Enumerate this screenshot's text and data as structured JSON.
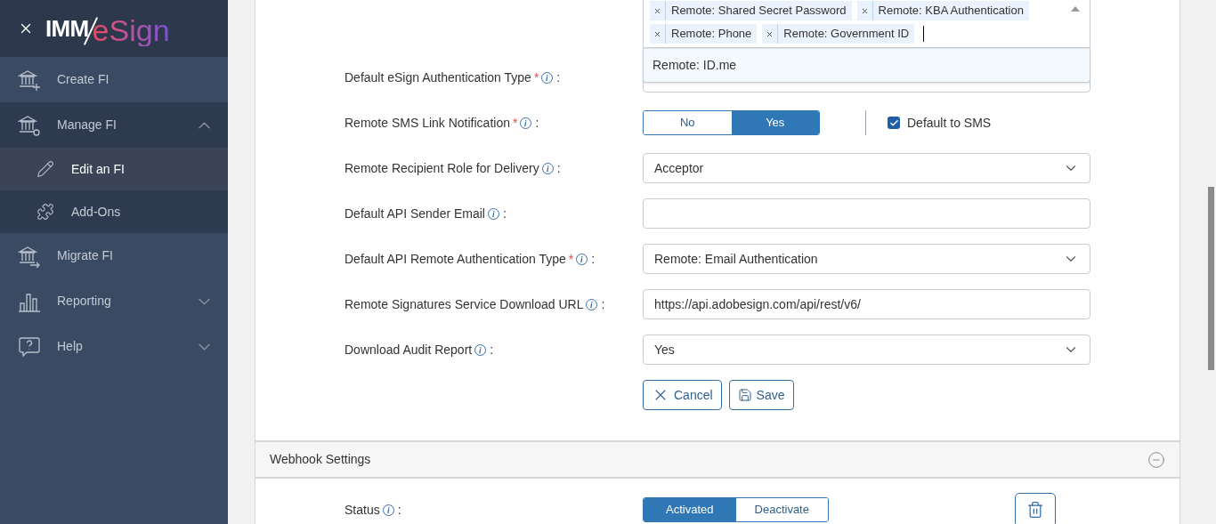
{
  "sidebar": {
    "logo": {
      "left": "IMM",
      "right": "eSign"
    },
    "items": [
      {
        "label": "Create FI",
        "selected": false
      },
      {
        "label": "Manage FI",
        "selected": false,
        "expanded": true,
        "children": [
          {
            "label": "Edit an FI",
            "selected": true
          },
          {
            "label": "Add-Ons",
            "selected": false
          }
        ]
      },
      {
        "label": "Migrate FI",
        "selected": false
      },
      {
        "label": "Reporting",
        "selected": false,
        "expanded": false
      },
      {
        "label": "Help",
        "selected": false,
        "expanded": false
      }
    ]
  },
  "auth_dropdown": {
    "chips": [
      "Remote: Shared Secret Password",
      "Remote: KBA Authentication",
      "Remote: Phone",
      "Remote: Government ID"
    ],
    "options": [
      "Remote: ID.me"
    ]
  },
  "form": [
    {
      "kind": "select",
      "label": "Default eSign Authentication Type",
      "required_mark": "*",
      "colon": ":"
    },
    {
      "kind": "toggle",
      "label": "Remote SMS Link Notification",
      "required_mark": "*",
      "colon": ":",
      "options": [
        {
          "label": "No",
          "selected": false
        },
        {
          "label": "Yes",
          "selected": true
        }
      ],
      "checkbox": {
        "label": "Default to SMS",
        "checked": true
      }
    },
    {
      "kind": "select",
      "label": "Remote Recipient Role for Delivery",
      "colon": ":",
      "value": "Acceptor"
    },
    {
      "kind": "text",
      "label": "Default API Sender Email",
      "colon": ":"
    },
    {
      "kind": "select",
      "label": "Default API Remote Authentication Type",
      "required_mark": "*",
      "colon": ":",
      "value": "Remote: Email Authentication"
    },
    {
      "kind": "text",
      "label": "Remote Signatures Service Download URL",
      "colon": ":",
      "value": "https://api.adobesign.com/api/rest/v6/"
    },
    {
      "kind": "select",
      "label": "Download Audit Report",
      "colon": ":",
      "value": "Yes"
    }
  ],
  "actions": [
    "Cancel",
    "Save"
  ],
  "webhook": {
    "title": "Webhook Settings",
    "expanded": true,
    "status": {
      "label": "Status",
      "colon": ":",
      "options": [
        {
          "label": "Activated",
          "selected": true
        },
        {
          "label": "Deactivate",
          "selected": false
        }
      ]
    }
  }
}
